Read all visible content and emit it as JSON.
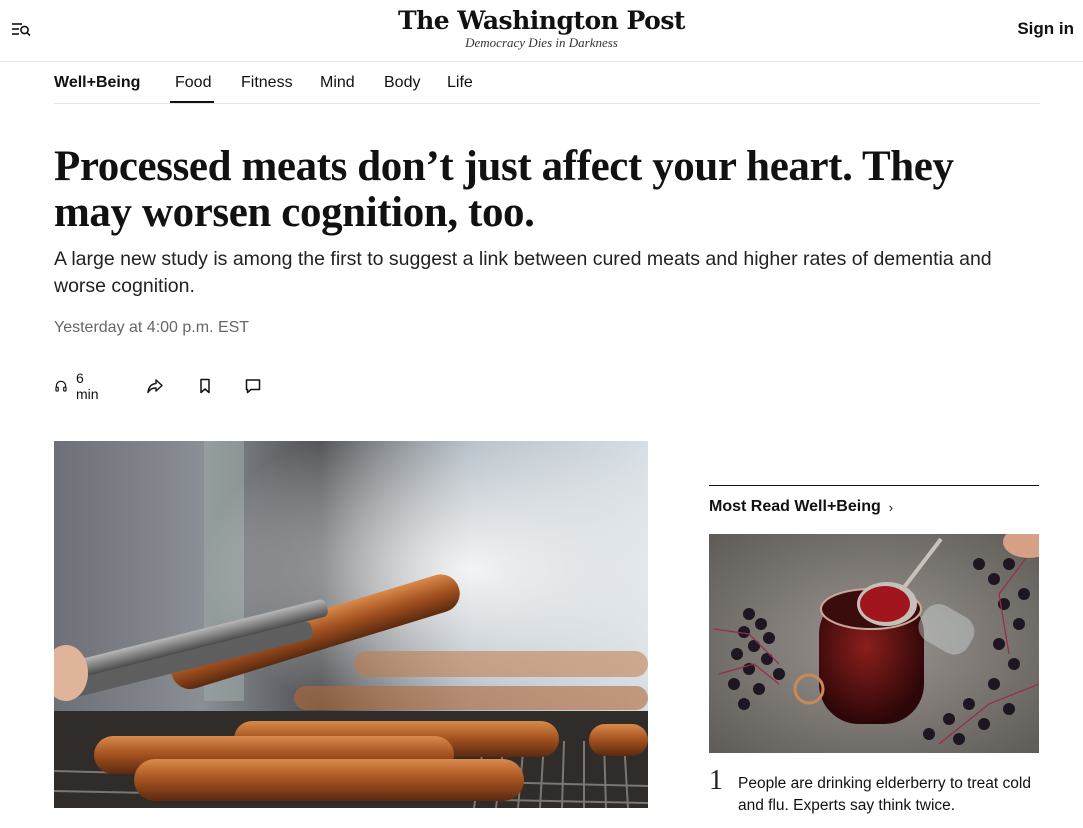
{
  "header": {
    "logo": "The Washington Post",
    "tagline": "Democracy Dies in Darkness",
    "sign_in": "Sign in",
    "menu_icon": "menu-search-icon"
  },
  "subnav": {
    "brand": "Well+Being",
    "items": [
      "Food",
      "Fitness",
      "Mind",
      "Body",
      "Life"
    ],
    "active": "Food"
  },
  "article": {
    "headline": "Processed meats don’t just affect your heart. They may worsen cognition, too.",
    "dek": "A large new study is among the first to suggest a link between cured meats and higher rates of dementia and worse cognition.",
    "timestamp": "Yesterday at 4:00 p.m. EST",
    "listen_duration": "6 min",
    "tool_icons": [
      "headphones-icon",
      "share-icon",
      "bookmark-icon",
      "comment-icon"
    ],
    "hero_image": "sausages-on-grill-with-tongs"
  },
  "most_read": {
    "title": "Most Read Well+Being",
    "chevron": "›",
    "items": [
      {
        "number": "1",
        "text": "People are drinking elderberry to treat cold and flu. Experts say think twice.",
        "image": "elderberry-syrup-jar-with-spoon"
      }
    ]
  }
}
